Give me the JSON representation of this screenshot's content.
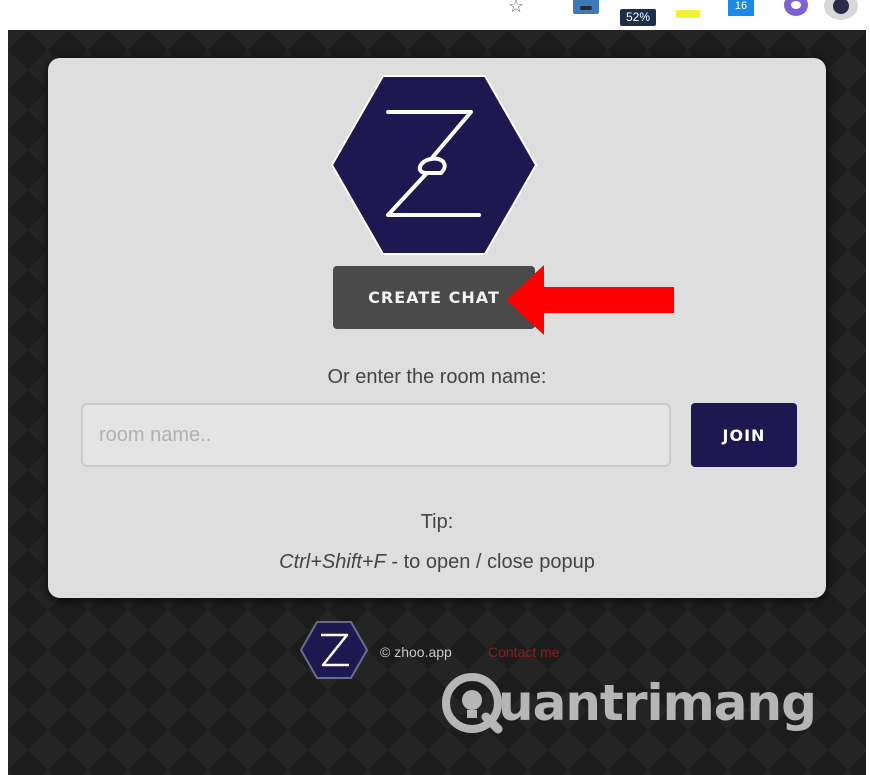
{
  "toolbar": {
    "icons": [
      "bookmark-star-icon",
      "mustache-extension-icon",
      "battery-extension-icon",
      "highlighter-extension-icon",
      "calendar-extension-icon",
      "purple-extension-icon",
      "zhoo-extension-icon"
    ],
    "badge_text": "52%",
    "calendar_text": "16"
  },
  "popup": {
    "create_button": "CREATE CHAT",
    "room_prompt": "Or enter the room name:",
    "room_placeholder": "room name..",
    "join_button": "JOIN",
    "tip_label": "Tip:",
    "tip_shortcut": "Ctrl+Shift+F",
    "tip_text": " - to open / close popup"
  },
  "footer": {
    "copyright": "© zhoo.app",
    "contact_link": "Contact me"
  },
  "watermark": {
    "text": "uantrimang"
  },
  "colors": {
    "brand_navy": "#1d1850",
    "create_button_bg": "#4a4a4a",
    "card_bg": "#dedede",
    "arrow_red": "#ff0000",
    "contact_red": "#8a1f1f"
  }
}
